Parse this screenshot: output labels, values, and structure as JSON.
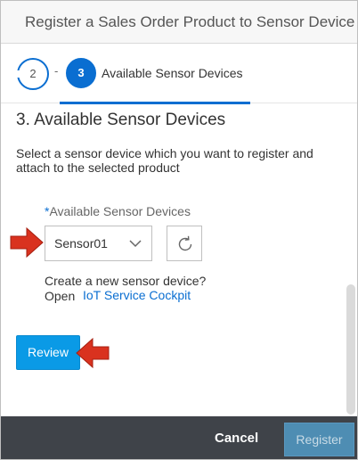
{
  "dialog": {
    "title": "Register a Sales Order Product to Sensor Device"
  },
  "wizard": {
    "prev_step_number": "2",
    "separator": "-",
    "current_step_number": "3",
    "current_step_label": "Available Sensor Devices"
  },
  "section": {
    "title": "3. Available Sensor Devices",
    "description": "Select a sensor device which you want to register and attach to the selected product"
  },
  "field": {
    "required_marker": "*",
    "label": "Available Sensor Devices",
    "selected_value": "Sensor01"
  },
  "create": {
    "question": "Create a new sensor device?",
    "open_text": "Open",
    "link_text": "IoT Service Cockpit"
  },
  "buttons": {
    "review": "Review",
    "cancel": "Cancel",
    "register": "Register"
  },
  "icons": {
    "select_chevron": "chevron-down-icon",
    "refresh": "refresh-icon",
    "callout_arrow": "red-arrow-icon"
  },
  "colors": {
    "accent": "#0a6ed1",
    "review_button": "#0a9ae6",
    "footer": "#3f4349",
    "register_button": "#4e8db3",
    "arrow": "#d9321f"
  }
}
